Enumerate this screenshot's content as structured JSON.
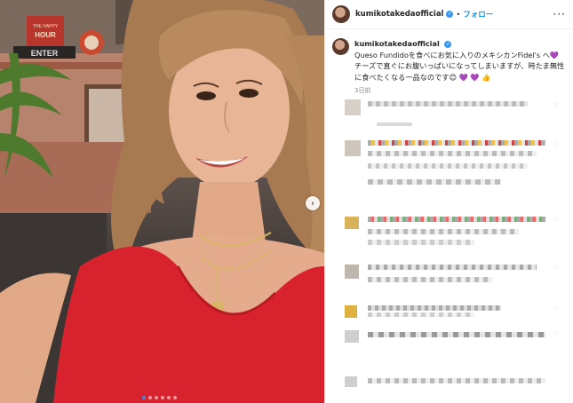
{
  "post": {
    "username": "kumikotakedaofficial",
    "verified_icon": "verified-badge-icon",
    "separator": "•",
    "follow_label": "フォロー",
    "more_label": "···",
    "caption_username": "kumikotakedaofficial",
    "caption_text": "Queso Fundidoを食べにお気に入りのメキシカンFidel's へ💜 チーズで直ぐにお腹いっぱいになってしまいますが、時たま無性に食べたくなる一品なのです😊 💜 💜 👍",
    "time_ago": "3日前"
  },
  "carousel": {
    "next_icon": "chevron-right-icon",
    "next_symbol": "›",
    "dot_count": 6,
    "active_index": 0
  },
  "sign": {
    "text1": "THE HAPPY",
    "text2": "HOUR",
    "text3": "ENTER"
  },
  "comments": {
    "count_visible": 9,
    "blurred": true,
    "heart_icon": "heart-icon",
    "heart_symbol": "♡"
  },
  "colors": {
    "accent": "#0095f6",
    "verified": "#3897f0",
    "dress_red": "#d8232f"
  }
}
